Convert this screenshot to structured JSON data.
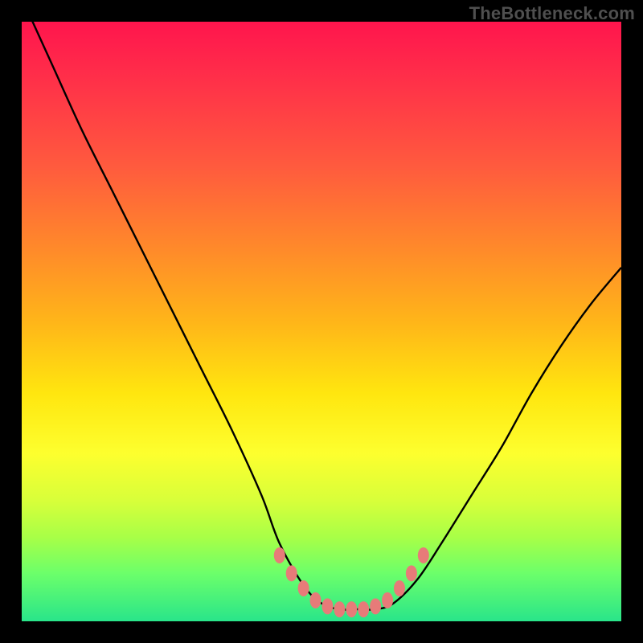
{
  "watermark": "TheBottleneck.com",
  "chart_data": {
    "type": "line",
    "title": "",
    "xlabel": "",
    "ylabel": "",
    "xlim": [
      0,
      100
    ],
    "ylim": [
      0,
      100
    ],
    "grid": false,
    "legend": false,
    "series": [
      {
        "name": "bottleneck-curve",
        "color": "#000000",
        "x": [
          0,
          5,
          10,
          15,
          20,
          25,
          30,
          35,
          40,
          43,
          47,
          50,
          53,
          56,
          59,
          62,
          66,
          70,
          75,
          80,
          85,
          90,
          95,
          100
        ],
        "y": [
          104,
          93,
          82,
          72,
          62,
          52,
          42,
          32,
          21,
          13,
          6,
          3,
          2,
          2,
          2,
          3,
          7,
          13,
          21,
          29,
          38,
          46,
          53,
          59
        ]
      }
    ],
    "markers": {
      "name": "trough-markers",
      "color": "#e77b79",
      "points": [
        {
          "x": 43,
          "y": 11
        },
        {
          "x": 45,
          "y": 8
        },
        {
          "x": 47,
          "y": 5.5
        },
        {
          "x": 49,
          "y": 3.5
        },
        {
          "x": 51,
          "y": 2.5
        },
        {
          "x": 53,
          "y": 2
        },
        {
          "x": 55,
          "y": 2
        },
        {
          "x": 57,
          "y": 2
        },
        {
          "x": 59,
          "y": 2.5
        },
        {
          "x": 61,
          "y": 3.5
        },
        {
          "x": 63,
          "y": 5.5
        },
        {
          "x": 65,
          "y": 8
        },
        {
          "x": 67,
          "y": 11
        }
      ]
    }
  },
  "colors": {
    "frame": "#000000",
    "marker": "#e77b79",
    "curve": "#000000"
  }
}
